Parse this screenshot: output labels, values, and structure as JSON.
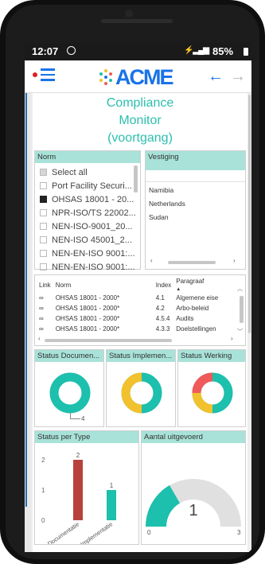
{
  "statusbar": {
    "time": "12:07",
    "battery": "85%"
  },
  "header": {
    "logo": "ACME",
    "back_label": "←",
    "forward_label": "→"
  },
  "page": {
    "title_lines": [
      "Compliance",
      "Monitor",
      "(voortgang)"
    ]
  },
  "norm": {
    "header": "Norm",
    "items": [
      {
        "label": "Select all",
        "state": "partial"
      },
      {
        "label": "Port Facility Securi...",
        "state": "off"
      },
      {
        "label": "OHSAS 18001 - 20...",
        "state": "on"
      },
      {
        "label": "NPR-ISO/TS 22002...",
        "state": "off"
      },
      {
        "label": "NEN-ISO-9001_20...",
        "state": "off"
      },
      {
        "label": "NEN-ISO 45001_2...",
        "state": "off"
      },
      {
        "label": "NEN-EN-ISO 9001:...",
        "state": "off"
      },
      {
        "label": "NEN-EN-ISO 9001:...",
        "state": "off"
      }
    ]
  },
  "vestiging": {
    "header": "Vestiging",
    "items": [
      "Namibia",
      "Netherlands",
      "Sudan"
    ]
  },
  "links_table": {
    "columns": [
      "Link",
      "Norm",
      "Index",
      "Paragraaf"
    ],
    "rows": [
      {
        "norm": "OHSAS 18001 - 2000*",
        "index": "4.1",
        "paragraaf": "Algemene eise"
      },
      {
        "norm": "OHSAS 18001 - 2000*",
        "index": "4.2",
        "paragraaf": "Arbo-beleid"
      },
      {
        "norm": "OHSAS 18001 - 2000*",
        "index": "4.5.4",
        "paragraaf": "Audits"
      },
      {
        "norm": "OHSAS 18001 - 2000*",
        "index": "4.3.3",
        "paragraaf": "Doelstellingen"
      }
    ]
  },
  "status_tiles": {
    "documentatie": {
      "header": "Status Documen...",
      "label": "4"
    },
    "implementatie": {
      "header": "Status Implemen..."
    },
    "werking": {
      "header": "Status Werking"
    }
  },
  "colors": {
    "teal": "#1dbfad",
    "yellow": "#f2c12e",
    "red": "#f05a5a",
    "bar_red": "#b8413c"
  },
  "chart_data": [
    {
      "type": "bar",
      "title": "Status per Type",
      "categories": [
        "Documentatie",
        "Implementatie"
      ],
      "values": [
        2,
        1
      ],
      "ylim": [
        0,
        2
      ],
      "yticks": [
        "0",
        "1",
        "2"
      ],
      "data_labels": [
        "2",
        "1"
      ]
    },
    {
      "type": "gauge",
      "title": "Aantal uitgevoerd",
      "value": 1,
      "min": 0,
      "max": 3,
      "min_label": "0",
      "max_label": "3",
      "value_label": "1"
    }
  ]
}
